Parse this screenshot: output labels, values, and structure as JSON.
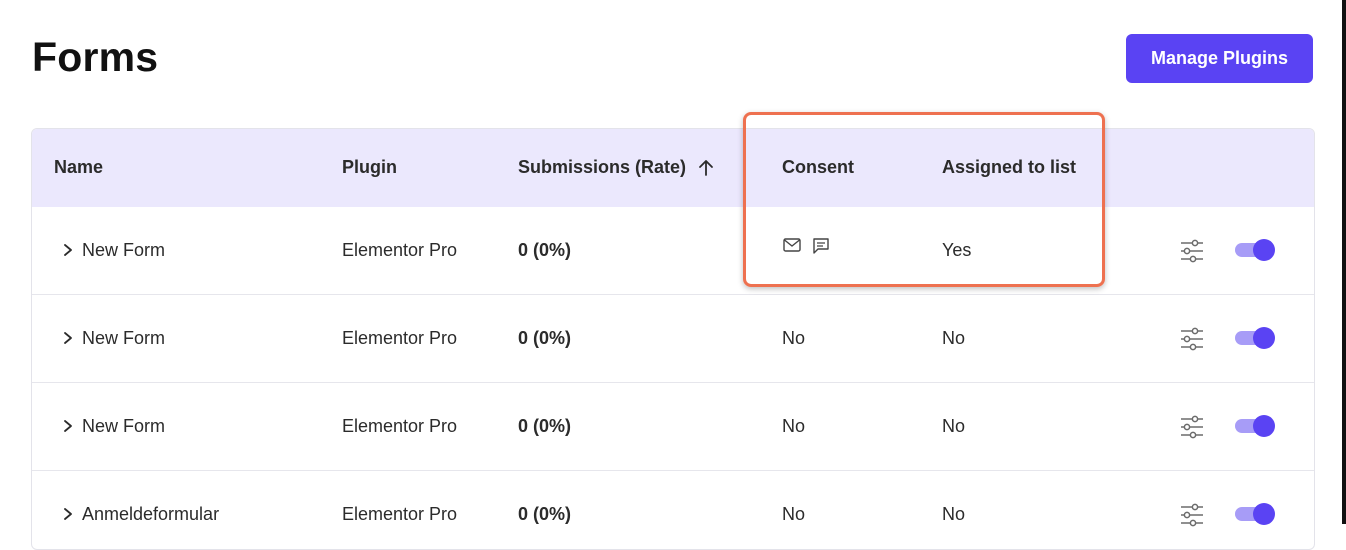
{
  "page": {
    "title": "Forms",
    "manage_button": "Manage Plugins"
  },
  "table": {
    "headers": {
      "name": "Name",
      "plugin": "Plugin",
      "submissions": "Submissions (Rate)",
      "consent": "Consent",
      "assigned": "Assigned to list"
    },
    "sort": {
      "column": "submissions",
      "direction": "ascending",
      "icon": "arrow-up-icon"
    },
    "rows": [
      {
        "name": "New Form",
        "plugin": "Elementor Pro",
        "submissions": "0 (0%)",
        "consent": "",
        "consent_icons": [
          "mail-icon",
          "message-icon"
        ],
        "assigned": "Yes",
        "enabled": true
      },
      {
        "name": "New Form",
        "plugin": "Elementor Pro",
        "submissions": "0 (0%)",
        "consent": "No",
        "consent_icons": [],
        "assigned": "No",
        "enabled": true
      },
      {
        "name": "New Form",
        "plugin": "Elementor Pro",
        "submissions": "0 (0%)",
        "consent": "No",
        "consent_icons": [],
        "assigned": "No",
        "enabled": true
      },
      {
        "name": "Anmeldeformular",
        "plugin": "Elementor Pro",
        "submissions": "0 (0%)",
        "consent": "No",
        "consent_icons": [],
        "assigned": "No",
        "enabled": true
      }
    ]
  },
  "colors": {
    "accent": "#5a43f3",
    "header_bg": "#ebe8fd",
    "highlight": "#ee7150"
  }
}
